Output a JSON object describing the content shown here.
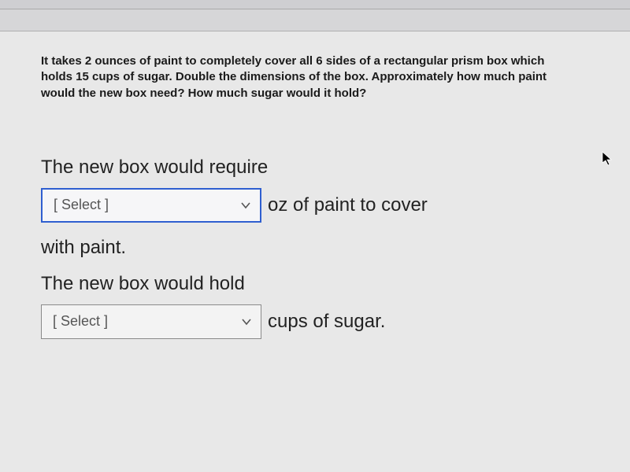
{
  "prompt": "It takes 2 ounces of paint to completely cover all 6 sides of a rectangular prism box which holds 15 cups of sugar. Double the dimensions of the box. Approximately how much paint would the new box need? How much sugar would it hold?",
  "answer": {
    "line1": "The new box would require",
    "select1_placeholder": "[ Select ]",
    "line1_after": "oz of paint to cover",
    "line2": "with paint.",
    "line3": "The new box would hold",
    "select2_placeholder": "[ Select ]",
    "line3_after": "cups of sugar."
  }
}
